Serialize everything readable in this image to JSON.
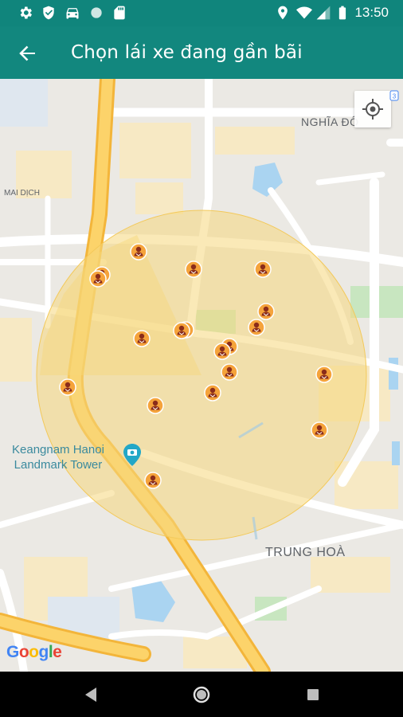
{
  "status_bar": {
    "time": "13:50",
    "icons": [
      "gear-icon",
      "shield-icon",
      "car-icon",
      "circle-icon",
      "sd-card-icon",
      "location-icon",
      "wifi-icon",
      "signal-icon",
      "battery-icon"
    ]
  },
  "app_bar": {
    "back_icon": "arrow-back-icon",
    "title": "Chọn lái xe đang gần bãi"
  },
  "map": {
    "labels": {
      "nghia_do": "NGHĨA ĐÔ",
      "mai_dich": "MAI DỊCH",
      "keangnam_line1": "Keangnam Hanoi",
      "keangnam_line2": "Landmark Tower",
      "trung_hoa": "TRUNG HOÀ",
      "google": "Google"
    },
    "my_location_icon": "crosshair-icon",
    "driver_marker_icon": "driver-pin-icon",
    "colors": {
      "search_area": "#f6d77b",
      "highway": "#f8c146",
      "marker": "#f5a33b"
    }
  },
  "nav_bar": {
    "back": "triangle-back-icon",
    "home": "circle-home-icon",
    "recents": "square-recents-icon"
  }
}
